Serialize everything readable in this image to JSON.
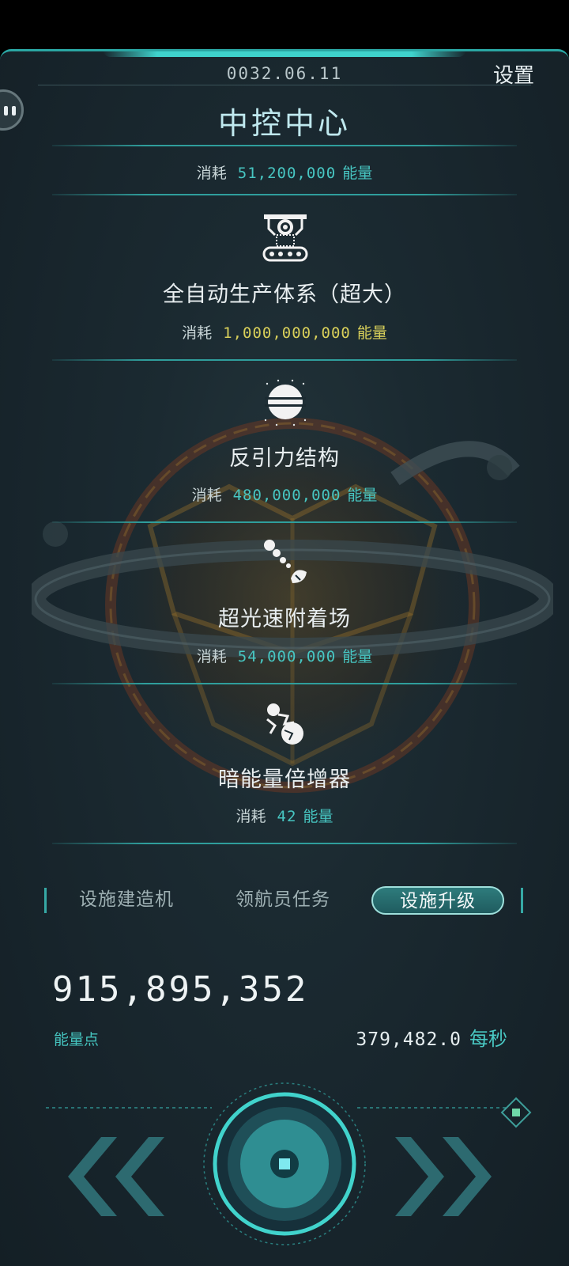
{
  "header": {
    "date": "0032.06.11",
    "settings_label": "设置",
    "title": "中控中心"
  },
  "center_cost": {
    "label": "消耗",
    "amount": "51,200,000",
    "unit": "能量"
  },
  "items": [
    {
      "name": "全自动生产体系（超大）",
      "icon": "factory-robot-icon",
      "cost_label": "消耗",
      "cost": "1,000,000,000",
      "unit": "能量",
      "cost_color": "#d9d05a"
    },
    {
      "name": "反引力结构",
      "icon": "planet-icon",
      "cost_label": "消耗",
      "cost": "480,000,000",
      "unit": "能量",
      "cost_color": "#47c6c2"
    },
    {
      "name": "超光速附着场",
      "icon": "satellite-dish-icon",
      "cost_label": "消耗",
      "cost": "54,000,000",
      "unit": "能量",
      "cost_color": "#47c6c2"
    },
    {
      "name": "暗能量倍增器",
      "icon": "dark-energy-icon",
      "cost_label": "消耗",
      "cost": "42",
      "unit": "能量",
      "cost_color": "#47c6c2"
    }
  ],
  "tabs": [
    {
      "label": "设施建造机",
      "active": false
    },
    {
      "label": "领航员任务",
      "active": false
    },
    {
      "label": "设施升级",
      "active": true
    }
  ],
  "resources": {
    "energy_points": "915,895,352",
    "energy_label": "能量点",
    "rate_value": "379,482.0",
    "rate_unit": "每秒"
  },
  "colors": {
    "accent": "#2f9e9c",
    "accent_text": "#47c6c2",
    "gold": "#d9d05a",
    "background": "#1b2a31"
  }
}
